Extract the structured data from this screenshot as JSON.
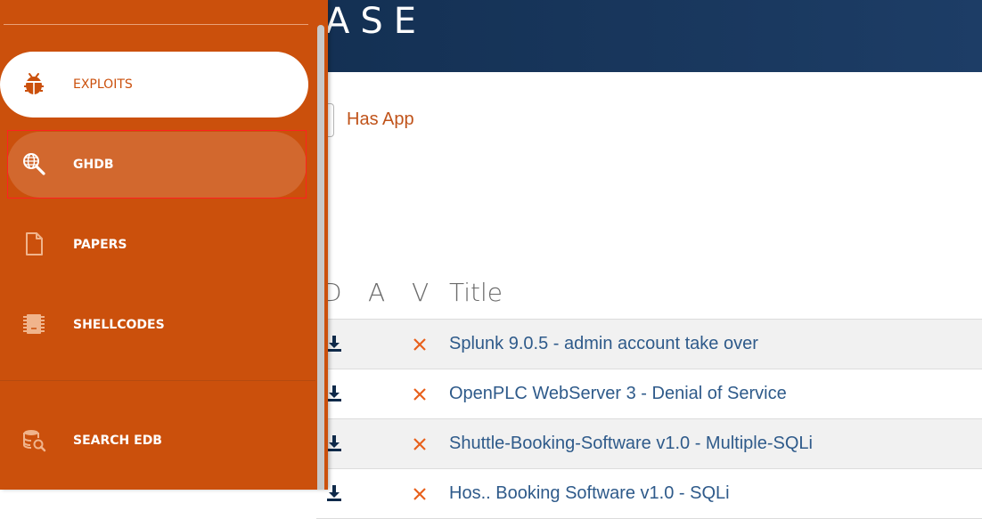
{
  "header": {
    "title_fragment": "ASE"
  },
  "filters": {
    "has_app_label": "Has App"
  },
  "table": {
    "columns": [
      "D",
      "A",
      "V",
      "Title"
    ],
    "rows": [
      {
        "title": "Splunk 9.0.5 - admin account take over",
        "verified": false
      },
      {
        "title": "OpenPLC WebServer 3 - Denial of Service",
        "verified": false
      },
      {
        "title": "Shuttle-Booking-Software v1.0 - Multiple-SQLi",
        "verified": false
      },
      {
        "title": "Hos.. Booking Software v1.0 - SQLi",
        "verified": false
      }
    ]
  },
  "sidebar": {
    "items": [
      {
        "label": "EXPLOITS",
        "icon": "bug-icon",
        "state": "active"
      },
      {
        "label": "GHDB",
        "icon": "globe-search-icon",
        "state": "hover"
      },
      {
        "label": "PAPERS",
        "icon": "document-icon",
        "state": "normal"
      },
      {
        "label": "SHELLCODES",
        "icon": "chip-icon",
        "state": "normal"
      },
      {
        "label": "SEARCH EDB",
        "icon": "database-search-icon",
        "state": "normal"
      }
    ]
  },
  "colors": {
    "sidebar_bg": "#cb500c",
    "header_bg": "#1d3d66",
    "accent_orange": "#e8601c",
    "link_blue": "#2e5a8a"
  }
}
